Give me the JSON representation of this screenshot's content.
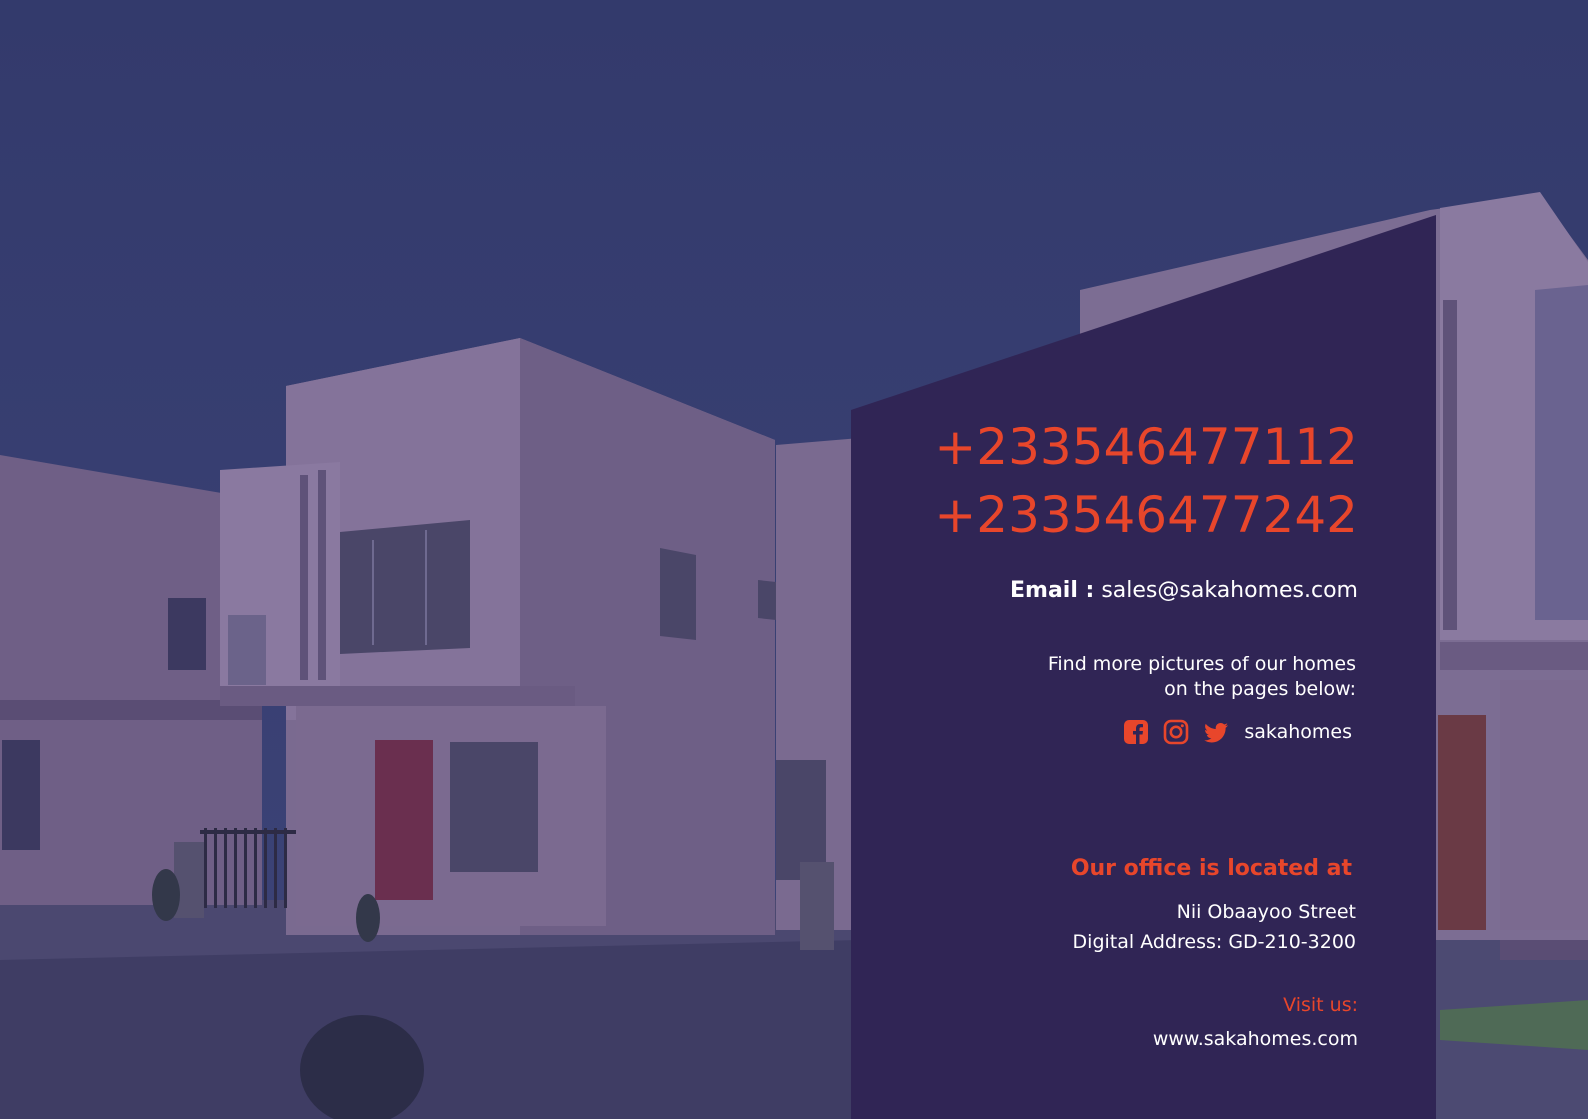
{
  "contact": {
    "phone_1": "+233546477112",
    "phone_2": "+233546477242",
    "email_label": "Email :",
    "email_value": "sales@sakahomes.com"
  },
  "social": {
    "intro_line_1": "Find more pictures of our homes",
    "intro_line_2": "on the pages below:",
    "icons": [
      "facebook-icon",
      "instagram-icon",
      "twitter-icon"
    ],
    "handle": "sakahomes"
  },
  "office": {
    "heading": "Our office is located at",
    "street": "Nii Obaayoo Street",
    "digital_address": "Digital Address: GD-210-3200"
  },
  "visit": {
    "label": "Visit us:",
    "website": "www.sakahomes.com"
  },
  "colors": {
    "accent": "#e8462b",
    "panel": "#302555",
    "overlay": "#3b3f72",
    "text": "#ffffff"
  }
}
